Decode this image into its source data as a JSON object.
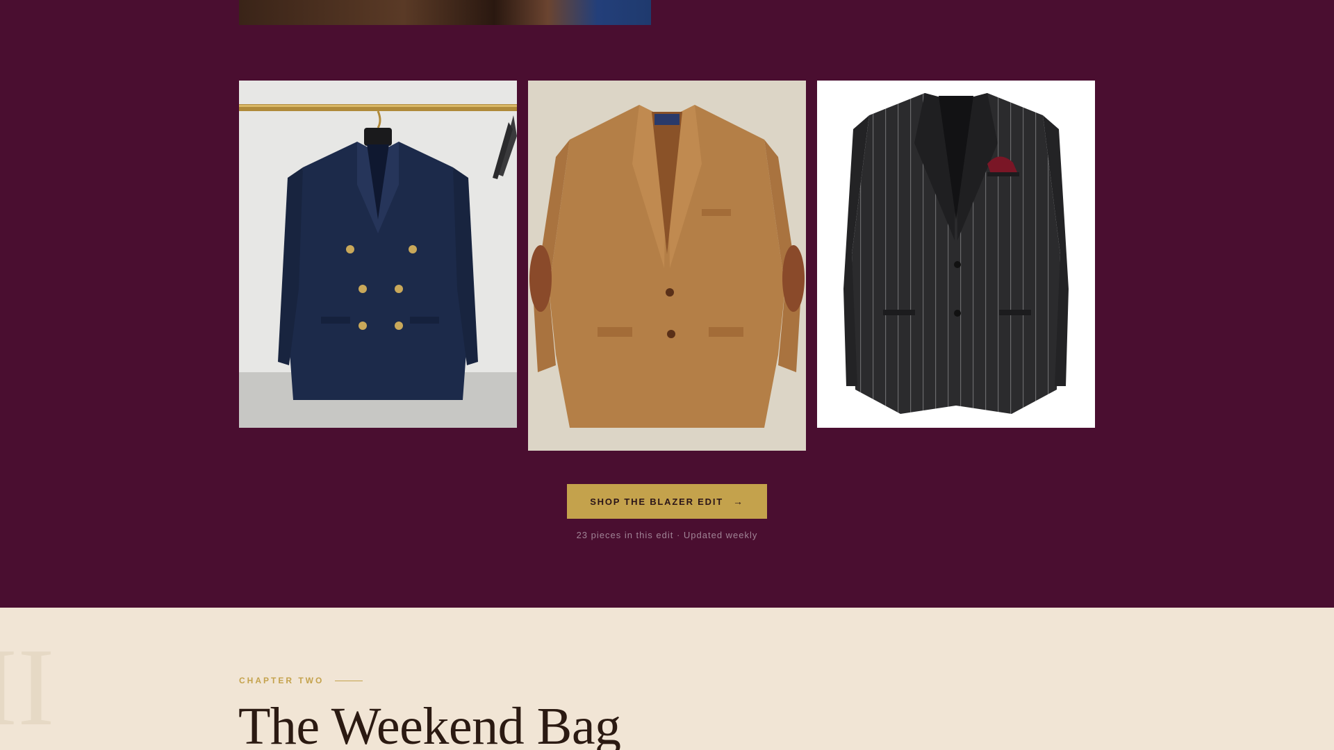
{
  "blazer_edit": {
    "products": [
      {
        "name": "Navy double-breasted blazer"
      },
      {
        "name": "Herringbone tweed jacket with elbow patches"
      },
      {
        "name": "Charcoal pinstripe jacket"
      }
    ],
    "cta_label": "SHOP THE BLAZER EDIT",
    "cta_icon": "arrow-right-icon",
    "note": "23 pieces in this edit · Updated weekly"
  },
  "chapter": {
    "numeral": "II",
    "eyebrow": "CHAPTER TWO",
    "title": "The Weekend Bag"
  },
  "colors": {
    "background": "#4a0e30",
    "accent_gold": "#c4a24c",
    "cream": "#f1e5d5",
    "title_ink": "#2b1a12"
  }
}
